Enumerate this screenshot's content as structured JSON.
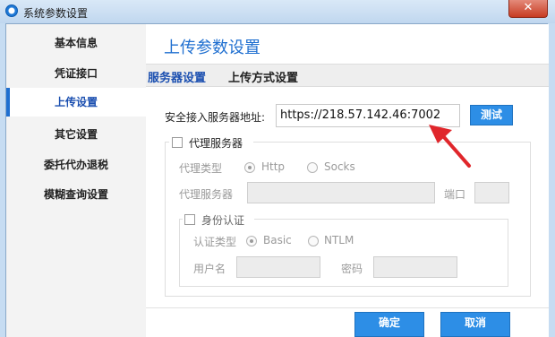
{
  "window": {
    "title": "系统参数设置",
    "close_glyph": "✕"
  },
  "sidebar": {
    "items": [
      {
        "label": "基本信息"
      },
      {
        "label": "凭证接口"
      },
      {
        "label": "上传设置"
      },
      {
        "label": "其它设置"
      },
      {
        "label": "委托代办退税"
      },
      {
        "label": "模糊查询设置"
      }
    ],
    "active": "上传设置"
  },
  "main": {
    "title": "上传参数设置",
    "tabs": [
      {
        "label": "服务器设置"
      },
      {
        "label": "上传方式设置"
      }
    ],
    "active_tab": "服务器设置",
    "server": {
      "address_label": "安全接入服务器地址:",
      "address_value": "https://218.57.142.46:7002",
      "test_button": "测试"
    },
    "proxy": {
      "checkbox_label": "代理服务器",
      "checked": false,
      "type_label": "代理类型",
      "type_options": [
        "Http",
        "Socks"
      ],
      "type_selected": "Http",
      "server_label": "代理服务器",
      "server_value": "",
      "port_label": "端口",
      "port_value": ""
    },
    "auth": {
      "checkbox_label": "身份认证",
      "checked": false,
      "type_label": "认证类型",
      "type_options": [
        "Basic",
        "NTLM"
      ],
      "type_selected": "Basic",
      "user_label": "用户名",
      "user_value": "",
      "password_label": "密码",
      "password_value": ""
    },
    "footer_buttons": [
      {
        "label": "确定"
      },
      {
        "label": "取消"
      }
    ]
  },
  "colors": {
    "accent": "#1f6fd0",
    "arrow": "#e0262b",
    "button": "#2d8ee6"
  }
}
